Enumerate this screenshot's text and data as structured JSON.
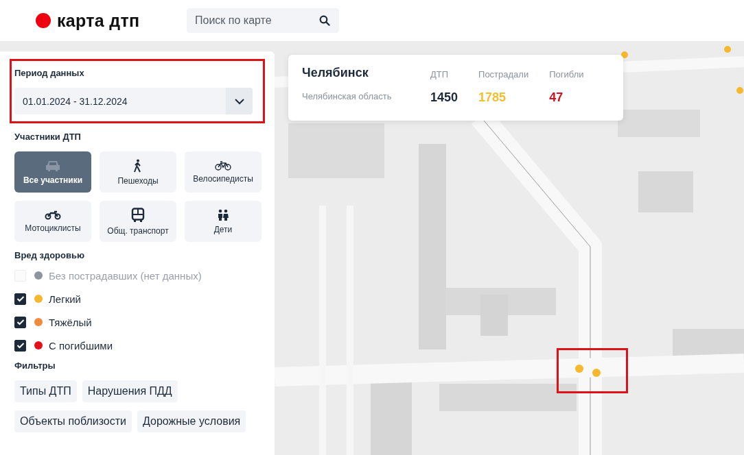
{
  "header": {
    "logo": "карта дтп",
    "search": {
      "placeholder": "Поиск по карте"
    }
  },
  "period": {
    "label": "Период данных",
    "value": "01.01.2024 - 31.12.2024"
  },
  "participants": {
    "title": "Участники ДТП",
    "items": [
      {
        "label": "Все участники",
        "kind": "car",
        "selected": true
      },
      {
        "label": "Пешеходы",
        "kind": "pedestrian",
        "selected": false
      },
      {
        "label": "Велосипедисты",
        "kind": "bicycle",
        "selected": false
      },
      {
        "label": "Мотоциклисты",
        "kind": "motorcycle",
        "selected": false
      },
      {
        "label": "Общ. транспорт",
        "kind": "bus",
        "selected": false
      },
      {
        "label": "Дети",
        "kind": "children",
        "selected": false
      }
    ]
  },
  "health": {
    "title": "Вред здоровью",
    "items": [
      {
        "label": "Без пострадавших (нет данных)",
        "color": "#8e959e",
        "checked": false,
        "disabled": true
      },
      {
        "label": "Легкий",
        "color": "#f5b82e",
        "checked": true,
        "disabled": false
      },
      {
        "label": "Тяжёлый",
        "color": "#f08a3c",
        "checked": true,
        "disabled": false
      },
      {
        "label": "С погибшими",
        "color": "#e3111b",
        "checked": true,
        "disabled": false
      }
    ]
  },
  "filters": {
    "title": "Фильтры",
    "items": [
      "Типы ДТП",
      "Нарушения ПДД",
      "Объекты поблизости",
      "Дорожные условия"
    ]
  },
  "stats": {
    "city": "Челябинск",
    "region": "Челябинская область",
    "metrics": [
      {
        "label": "ДТП",
        "value": "1450",
        "color": "#1d2a3a"
      },
      {
        "label": "Пострадали",
        "value": "1785",
        "color": "#f0c02e"
      },
      {
        "label": "Погибли",
        "value": "47",
        "color": "#d0121e"
      }
    ]
  }
}
